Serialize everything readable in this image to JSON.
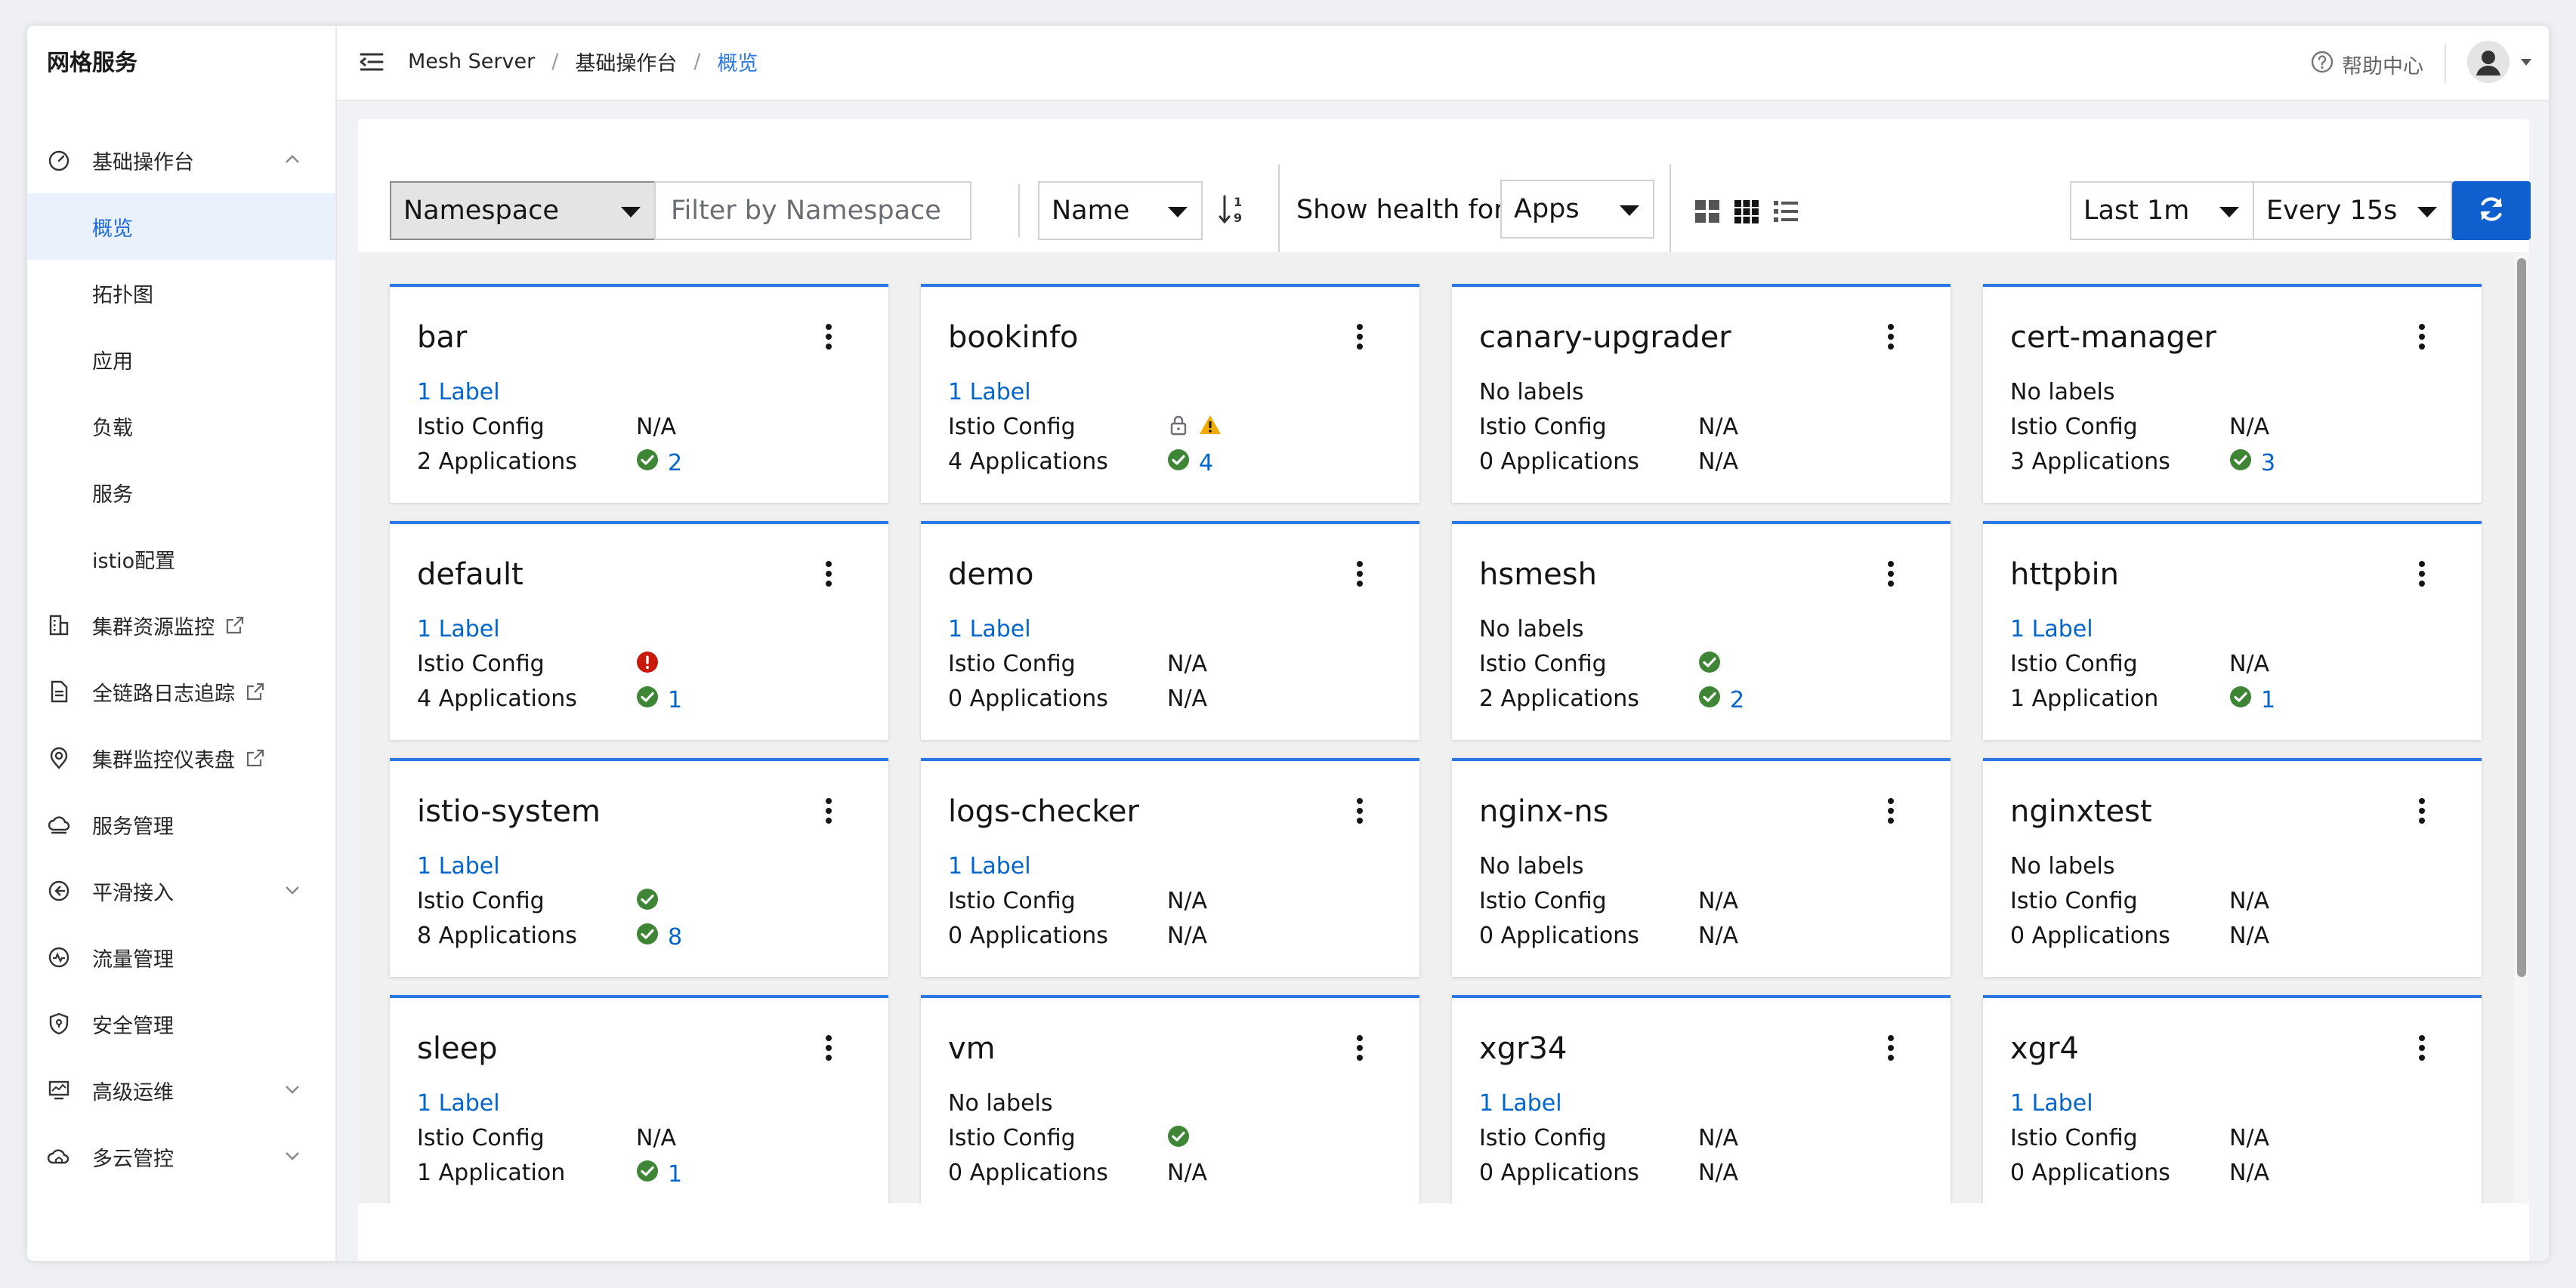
{
  "sidebar": {
    "brand": "网格服务",
    "items": [
      {
        "label": "基础操作台",
        "icon": "dashboard-gauge-icon",
        "expanded": true
      },
      {
        "label": "概览",
        "active": true
      },
      {
        "label": "拓扑图"
      },
      {
        "label": "应用"
      },
      {
        "label": "负载"
      },
      {
        "label": "服务"
      },
      {
        "label": "istio配置"
      },
      {
        "label": "集群资源监控",
        "icon": "building-icon",
        "external": true
      },
      {
        "label": "全链路日志追踪",
        "icon": "document-icon",
        "external": true
      },
      {
        "label": "集群监控仪表盘",
        "icon": "location-pin-icon",
        "external": true
      },
      {
        "label": "服务管理",
        "icon": "cloud-icon"
      },
      {
        "label": "平滑接入",
        "icon": "enter-circle-icon",
        "expanded": false
      },
      {
        "label": "流量管理",
        "icon": "pulse-icon"
      },
      {
        "label": "安全管理",
        "icon": "shield-icon"
      },
      {
        "label": "高级运维",
        "icon": "monitor-icon",
        "expanded": false
      },
      {
        "label": "多云管控",
        "icon": "cloud-house-icon",
        "expanded": false
      }
    ]
  },
  "header": {
    "breadcrumb": [
      "Mesh Server",
      "基础操作台",
      "概览"
    ],
    "help_label": "帮助中心"
  },
  "toolbar": {
    "filter_type": "Namespace",
    "filter_placeholder": "Filter by Namespace",
    "sort_field": "Name",
    "health_label": "Show health for",
    "health_type": "Apps",
    "time_range": "Last 1m",
    "refresh_interval": "Every 15s"
  },
  "colors": {
    "accent": "#2b78e4",
    "link": "#0066cc",
    "ok": "#3e8635",
    "warning": "#f0ab00",
    "error": "#c9190b",
    "refresh_button": "#0f5fce"
  },
  "cards": [
    {
      "name": "bar",
      "labels": "1 Label",
      "labels_link": true,
      "config": "N/A",
      "apps_label": "2 Applications",
      "apps": {
        "status": "ok",
        "count": "2"
      }
    },
    {
      "name": "bookinfo",
      "labels": "1 Label",
      "labels_link": true,
      "config_icons": [
        "lock",
        "warning"
      ],
      "apps_label": "4 Applications",
      "apps": {
        "status": "ok",
        "count": "4"
      }
    },
    {
      "name": "canary-upgrader",
      "labels": "No labels",
      "labels_link": false,
      "config": "N/A",
      "apps_label": "0 Applications",
      "apps_text": "N/A"
    },
    {
      "name": "cert-manager",
      "labels": "No labels",
      "labels_link": false,
      "config": "N/A",
      "apps_label": "3 Applications",
      "apps": {
        "status": "ok",
        "count": "3"
      }
    },
    {
      "name": "default",
      "labels": "1 Label",
      "labels_link": true,
      "config_icons": [
        "error"
      ],
      "apps_label": "4 Applications",
      "apps": {
        "status": "ok",
        "count": "1"
      }
    },
    {
      "name": "demo",
      "labels": "1 Label",
      "labels_link": true,
      "config": "N/A",
      "apps_label": "0 Applications",
      "apps_text": "N/A"
    },
    {
      "name": "hsmesh",
      "labels": "No labels",
      "labels_link": false,
      "config_icons": [
        "ok"
      ],
      "apps_label": "2 Applications",
      "apps": {
        "status": "ok",
        "count": "2"
      }
    },
    {
      "name": "httpbin",
      "labels": "1 Label",
      "labels_link": true,
      "config": "N/A",
      "apps_label": "1 Application",
      "apps": {
        "status": "ok",
        "count": "1"
      }
    },
    {
      "name": "istio-system",
      "labels": "1 Label",
      "labels_link": true,
      "config_icons": [
        "ok"
      ],
      "apps_label": "8 Applications",
      "apps": {
        "status": "ok",
        "count": "8"
      }
    },
    {
      "name": "logs-checker",
      "labels": "1 Label",
      "labels_link": true,
      "config": "N/A",
      "apps_label": "0 Applications",
      "apps_text": "N/A"
    },
    {
      "name": "nginx-ns",
      "labels": "No labels",
      "labels_link": false,
      "config": "N/A",
      "apps_label": "0 Applications",
      "apps_text": "N/A"
    },
    {
      "name": "nginxtest",
      "labels": "No labels",
      "labels_link": false,
      "config": "N/A",
      "apps_label": "0 Applications",
      "apps_text": "N/A"
    },
    {
      "name": "sleep",
      "labels": "1 Label",
      "labels_link": true,
      "config": "N/A",
      "apps_label": "1 Application",
      "apps": {
        "status": "ok",
        "count": "1"
      }
    },
    {
      "name": "vm",
      "labels": "No labels",
      "labels_link": false,
      "config_icons": [
        "ok"
      ],
      "apps_label": "0 Applications",
      "apps_text": "N/A"
    },
    {
      "name": "xgr34",
      "labels": "1 Label",
      "labels_link": true,
      "config": "N/A",
      "apps_label": "0 Applications",
      "apps_text": "N/A"
    },
    {
      "name": "xgr4",
      "labels": "1 Label",
      "labels_link": true,
      "config": "N/A",
      "apps_label": "0 Applications",
      "apps_text": "N/A"
    }
  ]
}
